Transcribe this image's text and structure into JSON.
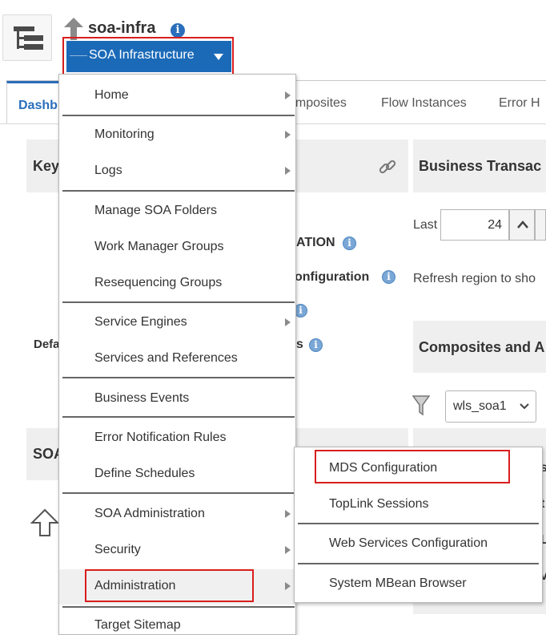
{
  "header": {
    "title": "soa-infra",
    "target_button_label": "SOA Infrastructure"
  },
  "tabs": {
    "dashboard": "Dashb",
    "composites": "omposites",
    "flow_instances": "Flow Instances",
    "error": "Error H"
  },
  "background": {
    "key_panel_title": "Key",
    "business_panel_title": "Business Transac",
    "last_label": "Last",
    "last_value": "24",
    "refresh_text": "Refresh region to sho",
    "ation_text": "ATION",
    "configuration_text": "onfiguration",
    "s_text": "s",
    "defa_text": "Defa",
    "composites_panel_title": "Composites and A",
    "soa_panel_title": "SOA",
    "server_select_value": "wls_soa1",
    "sub_edge_1": "s",
    "sub_edge_2": "t",
    "sub_edge_3": "L",
    "sub_edge_4": "v"
  },
  "menu": {
    "home": "Home",
    "monitoring": "Monitoring",
    "logs": "Logs",
    "manage_soa_folders": "Manage SOA Folders",
    "work_manager_groups": "Work Manager Groups",
    "resequencing_groups": "Resequencing Groups",
    "service_engines": "Service Engines",
    "services_and_references": "Services and References",
    "business_events": "Business Events",
    "error_notification_rules": "Error Notification Rules",
    "define_schedules": "Define Schedules",
    "soa_administration": "SOA Administration",
    "security": "Security",
    "administration": "Administration",
    "target_sitemap": "Target Sitemap"
  },
  "submenu": {
    "mds_configuration": "MDS Configuration",
    "toplink_sessions": "TopLink Sessions",
    "web_services_configuration": "Web Services Configuration",
    "system_mbean_browser": "System MBean Browser"
  },
  "colors": {
    "accent": "#1b6ab8",
    "highlight_border": "#d81e1e"
  }
}
